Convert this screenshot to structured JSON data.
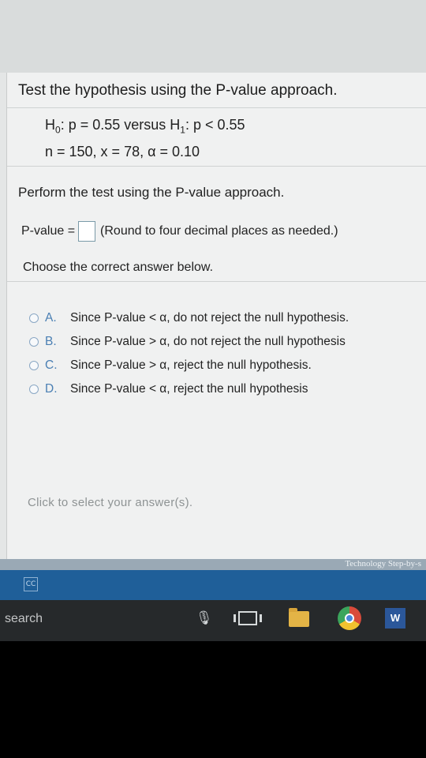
{
  "question": {
    "title": "Test the hypothesis using the P-value approach.",
    "h0_label": "H",
    "h0_sub": "0",
    "h0_text": ": p = 0.55 versus H",
    "h1_sub": "1",
    "h1_text": ": p < 0.55",
    "params": "n = 150, x = 78, α = 0.10",
    "instruction": "Perform the test using the P-value approach.",
    "pvalue_label": "P-value =",
    "pvalue_value": "",
    "pvalue_note": "(Round to four decimal places as needed.)",
    "choose_label": "Choose the correct answer below."
  },
  "options": [
    {
      "letter": "A.",
      "text": "Since P-value < α, do not reject the null hypothesis."
    },
    {
      "letter": "B.",
      "text": "Since P-value > α, do not reject the null hypothesis"
    },
    {
      "letter": "C.",
      "text": "Since P-value > α, reject the null hypothesis."
    },
    {
      "letter": "D.",
      "text": "Since P-value < α, reject the null hypothesis"
    }
  ],
  "footer": {
    "click_hint": "Click to select your answer(s).",
    "brand": "Technology Step-by-s"
  },
  "taskbar": {
    "search_placeholder": "search",
    "icons": [
      "cc-icon",
      "microphone-icon",
      "task-view-icon",
      "file-explorer-icon",
      "chrome-icon",
      "word-icon"
    ],
    "word_letter": "W"
  },
  "colors": {
    "content_bg": "#f0f1f1",
    "accent_blue": "#1f5f99",
    "taskbar": "#26292b",
    "option_letter": "#4a7fb3"
  }
}
